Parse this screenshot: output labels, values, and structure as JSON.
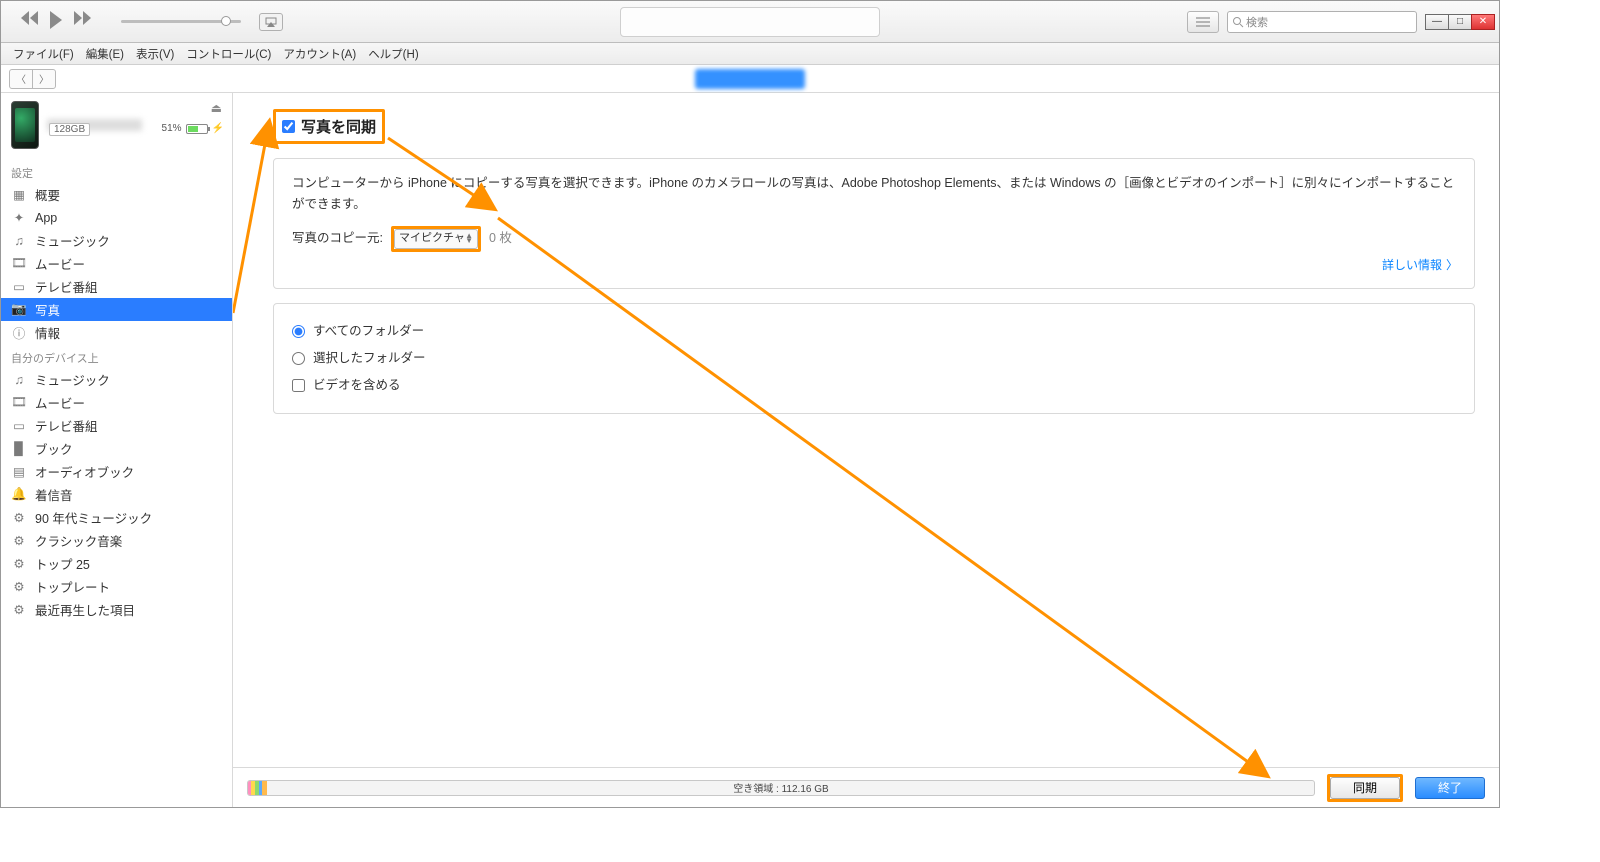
{
  "toolbar": {
    "search_placeholder": "検索"
  },
  "menu": {
    "file": "ファイル(F)",
    "edit": "編集(E)",
    "view": "表示(V)",
    "controls": "コントロール(C)",
    "account": "アカウント(A)",
    "help": "ヘルプ(H)"
  },
  "device": {
    "capacity": "128GB",
    "battery_pct": "51%"
  },
  "sidebar": {
    "section_settings": "設定",
    "settings": [
      {
        "label": "概要",
        "icon": "summary"
      },
      {
        "label": "App",
        "icon": "apps"
      },
      {
        "label": "ミュージック",
        "icon": "music"
      },
      {
        "label": "ムービー",
        "icon": "movie"
      },
      {
        "label": "テレビ番組",
        "icon": "tv"
      },
      {
        "label": "写真",
        "icon": "photo"
      },
      {
        "label": "情報",
        "icon": "info"
      }
    ],
    "section_device": "自分のデバイス上",
    "ondevice": [
      {
        "label": "ミュージック",
        "icon": "music"
      },
      {
        "label": "ムービー",
        "icon": "movie"
      },
      {
        "label": "テレビ番組",
        "icon": "tv"
      },
      {
        "label": "ブック",
        "icon": "book"
      },
      {
        "label": "オーディオブック",
        "icon": "audio"
      },
      {
        "label": "着信音",
        "icon": "bell"
      },
      {
        "label": "90 年代ミュージック",
        "icon": "gear"
      },
      {
        "label": "クラシック音楽",
        "icon": "gear"
      },
      {
        "label": "トップ 25",
        "icon": "gear"
      },
      {
        "label": "トップレート",
        "icon": "gear"
      },
      {
        "label": "最近再生した項目",
        "icon": "gear"
      }
    ]
  },
  "content": {
    "sync_label": "写真を同期",
    "description": "コンピューターから iPhone にコピーする写真を選択できます。iPhone のカメラロールの写真は、Adobe Photoshop Elements、または Windows の［画像とビデオのインポート］に別々にインポートすることができます。",
    "src_label": "写真のコピー元:",
    "src_value": "マイピクチャ",
    "src_count": "0 枚",
    "more_link": "詳しい情報",
    "opt_all": "すべてのフォルダー",
    "opt_selected": "選択したフォルダー",
    "opt_video": "ビデオを含める"
  },
  "bottom": {
    "free": "空き領域 : 112.16 GB",
    "sync": "同期",
    "done": "終了"
  }
}
